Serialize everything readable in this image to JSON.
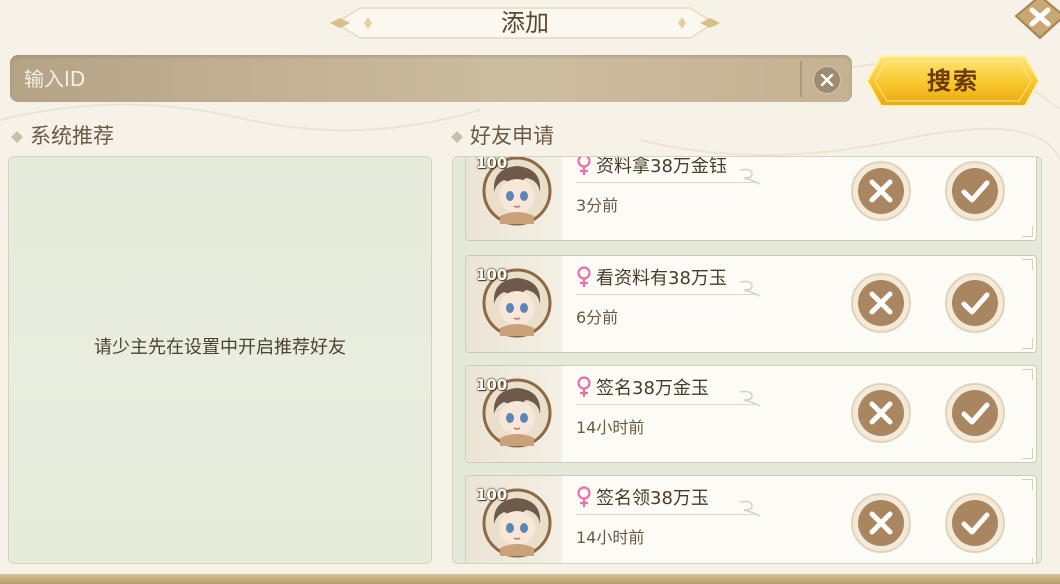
{
  "dialog": {
    "title": "添加"
  },
  "search": {
    "placeholder": "输入ID",
    "button_label": "搜索"
  },
  "recommend": {
    "section_title": "系统推荐",
    "empty_text": "请少主先在设置中开启推荐好友"
  },
  "requests": {
    "section_title": "好友申请",
    "items": [
      {
        "level": "100",
        "name": "资料拿38万金钰",
        "time": "3分前",
        "gender": "female"
      },
      {
        "level": "100",
        "name": "看资料有38万玉",
        "time": "6分前",
        "gender": "female"
      },
      {
        "level": "100",
        "name": "签名38万金玉",
        "time": "14小时前",
        "gender": "female"
      },
      {
        "level": "100",
        "name": "签名领38万玉",
        "time": "14小时前",
        "gender": "female"
      }
    ]
  },
  "colors": {
    "accent_gold": "#f5c62c",
    "panel_green": "#e6ebdc",
    "female_pink": "#e86ea8",
    "button_brown": "#a98660"
  },
  "icons": {
    "close": "close-icon",
    "clear": "clear-icon",
    "gender": "female-icon",
    "reject": "reject-icon",
    "accept": "accept-icon"
  }
}
